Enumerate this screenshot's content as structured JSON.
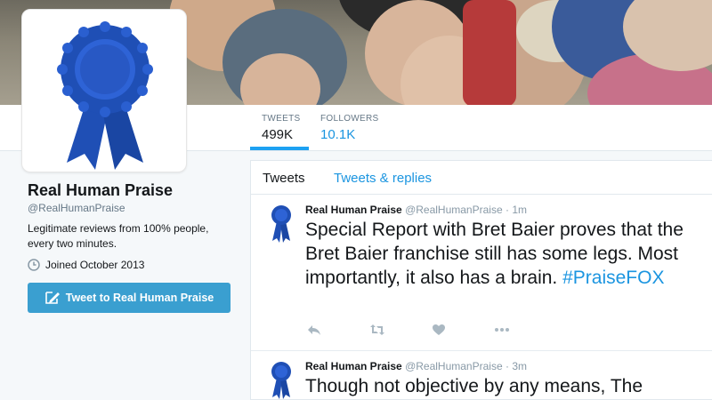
{
  "profile": {
    "name": "Real Human Praise",
    "handle": "@RealHumanPraise",
    "bio": "Legitimate reviews from 100% people, every two minutes.",
    "joined": "Joined October 2013",
    "tweet_to_label": "Tweet to Real Human Praise"
  },
  "stats": {
    "tweets_label": "TWEETS",
    "tweets_value": "499K",
    "followers_label": "FOLLOWERS",
    "followers_value": "10.1K"
  },
  "timeline": {
    "tabs": [
      {
        "label": "Tweets",
        "active": true
      },
      {
        "label": "Tweets & replies",
        "active": false
      }
    ],
    "tweets": [
      {
        "name": "Real Human Praise",
        "handle": "@RealHumanPraise",
        "separator": "·",
        "time": "1m",
        "text": "Special Report with Bret Baier proves that the Bret Baier franchise still has some legs. Most importantly, it also has a brain.",
        "hashtag": "#PraiseFOX"
      },
      {
        "name": "Real Human Praise",
        "handle": "@RealHumanPraise",
        "separator": "·",
        "time": "3m",
        "text": "Though not objective by any means, The"
      }
    ],
    "actions": [
      "reply-icon",
      "retweet-icon",
      "like-icon",
      "more-icon"
    ]
  },
  "colors": {
    "accent": "#1da1f2",
    "link": "#1b95e0",
    "button": "#3a9fd0",
    "ribbon": "#1f4fb5"
  }
}
